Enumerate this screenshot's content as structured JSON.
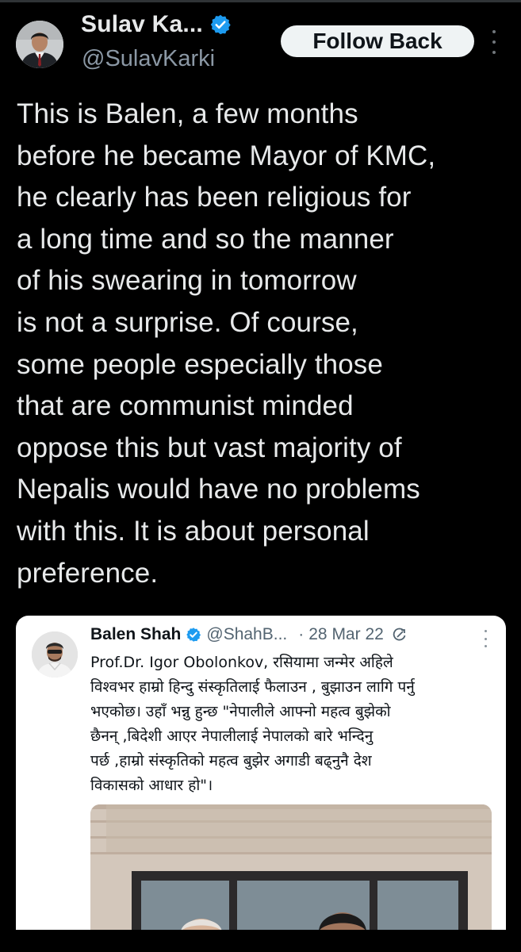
{
  "author": {
    "display_name": "Sulav Ka...",
    "handle": "@SulavKarki",
    "verified": true
  },
  "header": {
    "follow_label": "Follow Back"
  },
  "tweet": {
    "text": "This is Balen, a few months\nbefore he became Mayor of KMC,\nhe clearly has been religious for\na long time and so the manner\nof his swearing in tomorrow\nis not a surprise. Of course,\nsome people especially those\nthat are communist minded\noppose this but vast majority of\nNepalis would have no problems\nwith this. It is about personal\npreference."
  },
  "quoted_tweet": {
    "display_name": "Balen Shah",
    "handle": "@ShahB...",
    "separator": "·",
    "date": "28 Mar 22",
    "text": "Prof.Dr. Igor Obolonkov, रसियामा जन्मेर अहिले\nविश्वभर हाम्रो हिन्दु संस्कृतिलाई फैलाउन , बुझाउन लागि पर्नु\nभएकोछ। उहाँ भन्नु हुन्छ \"नेपालीले आफ्नो महत्व बुझेको\nछैनन् ,बिदेशी आएर नेपालीलाई नेपालको बारे भन्दिनु\nपर्छ ,हाम्रो संस्कृतिको महत्व बुझेर अगाडी बढ्नुनै देश\nविकासको आधार हो\"।"
  },
  "colors": {
    "background": "#000000",
    "text_primary": "#e7e9ea",
    "text_secondary": "#8b98a5",
    "verified_blue": "#1d9bf0",
    "card_background": "#ffffff"
  },
  "icons": {
    "verified": "verified-badge-icon",
    "more": "more-options-icon",
    "edited": "edit-history-icon"
  }
}
